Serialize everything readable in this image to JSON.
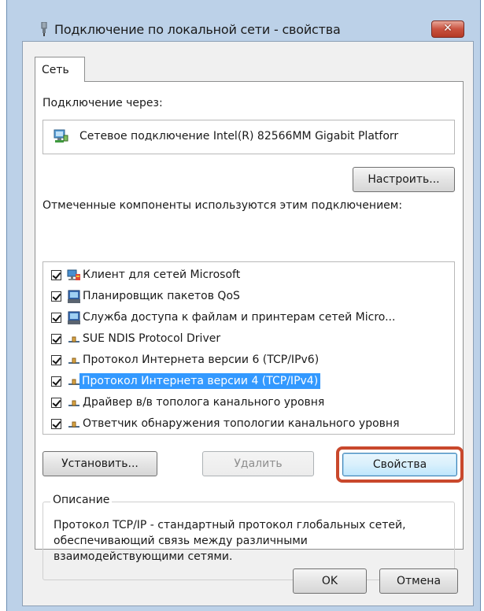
{
  "window": {
    "title": "Подключение по локальной сети - свойства",
    "close_label": "✕"
  },
  "tabs": [
    {
      "label": "Сеть",
      "active": true
    }
  ],
  "connect_via": {
    "label": "Подключение через:",
    "adapter_name": "Сетевое подключение Intel(R) 82566MM Gigabit Platforr",
    "configure_button": "Настроить..."
  },
  "components": {
    "label": "Отмеченные компоненты используются этим подключением:",
    "items": [
      {
        "label": "Клиент для сетей Microsoft",
        "checked": true,
        "icon": "network-client-icon",
        "selected": false
      },
      {
        "label": "Планировщик пакетов QoS",
        "checked": true,
        "icon": "service-icon",
        "selected": false
      },
      {
        "label": "Служба доступа к файлам и принтерам сетей Micro...",
        "checked": true,
        "icon": "service-icon",
        "selected": false
      },
      {
        "label": "SUE NDIS Protocol Driver",
        "checked": true,
        "icon": "protocol-icon",
        "selected": false
      },
      {
        "label": "Протокол Интернета версии 6 (TCP/IPv6)",
        "checked": true,
        "icon": "protocol-icon",
        "selected": false
      },
      {
        "label": "Протокол Интернета версии 4 (TCP/IPv4)",
        "checked": true,
        "icon": "protocol-icon",
        "selected": true
      },
      {
        "label": "Драйвер в/в тополога канального уровня",
        "checked": true,
        "icon": "protocol-icon",
        "selected": false
      },
      {
        "label": "Ответчик обнаружения топологии канального уровня",
        "checked": true,
        "icon": "protocol-icon",
        "selected": false
      }
    ]
  },
  "actions": {
    "install": "Установить...",
    "remove": "Удалить",
    "properties": "Свойства"
  },
  "description": {
    "title": "Описание",
    "text": "Протокол TCP/IP - стандартный протокол глобальных сетей, обеспечивающий связь между различными взаимодействующими сетями."
  },
  "footer": {
    "ok": "OK",
    "cancel": "Отмена"
  },
  "colors": {
    "selection": "#3399ff",
    "highlight_ring": "#c9482c",
    "window_frame": "#bcd1e8",
    "close_button": "#c9523f"
  }
}
